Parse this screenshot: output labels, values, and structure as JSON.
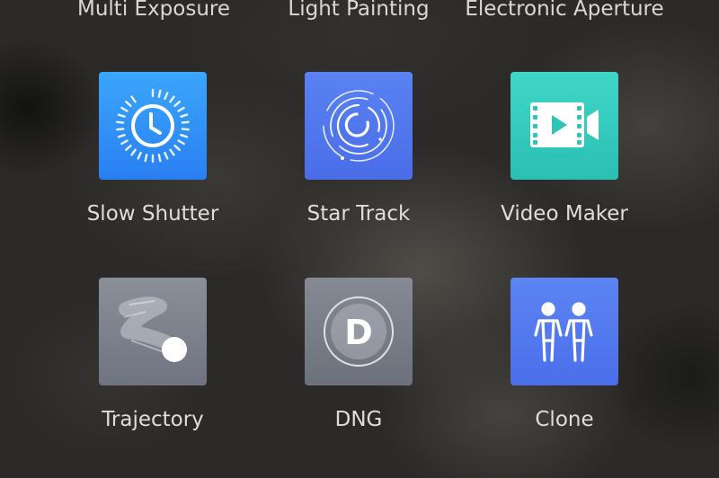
{
  "top_row": [
    {
      "label": "Multi Exposure"
    },
    {
      "label": "Light Painting"
    },
    {
      "label": "Electronic Aperture"
    }
  ],
  "modes": [
    {
      "label": "Slow Shutter",
      "icon": "slow-shutter-icon",
      "color_top": "#3aa6fb",
      "color_bottom": "#2a7ff2"
    },
    {
      "label": "Star Track",
      "icon": "star-track-icon",
      "color_top": "#5a82f2",
      "color_bottom": "#4a6de8"
    },
    {
      "label": "Video Maker",
      "icon": "video-maker-icon",
      "color_top": "#3fd6c8",
      "color_bottom": "#2bbfb3"
    },
    {
      "label": "Trajectory",
      "icon": "trajectory-icon",
      "color_top": "#8a8f99",
      "color_bottom": "#6f7480"
    },
    {
      "label": "DNG",
      "icon": "dng-icon",
      "color_top": "#858a94",
      "color_bottom": "#6c717c"
    },
    {
      "label": "Clone",
      "icon": "clone-icon",
      "color_top": "#5d84f3",
      "color_bottom": "#4a6fea"
    }
  ],
  "dng_glyph": "D"
}
